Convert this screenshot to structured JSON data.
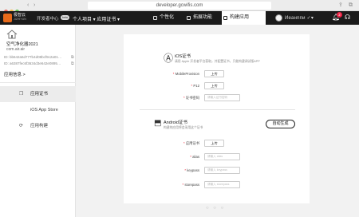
{
  "browser": {
    "url": "developer.gcwifis.com"
  },
  "header": {
    "brand_line1": "极智云",
    "brand_line2": "JIZHIYUN",
    "dev_center": "开发者中心",
    "badge": "beta",
    "breadcrumb": "个人项目 ▾ 应用证书 ▾",
    "tabs": [
      {
        "label": "个性化",
        "icon": "palette-icon"
      },
      {
        "label": "拓展功能",
        "icon": "puzzle-icon"
      },
      {
        "label": "构建应用",
        "icon": "build-icon",
        "active": true
      }
    ],
    "username": "Иeaнnnи ✓▾",
    "notification_count": "2"
  },
  "sidebar": {
    "app_name": "空气净化器2021",
    "app_package": "com.air.air",
    "ids": [
      {
        "label": "ID:",
        "value": "bb642a6d777b4d08bcf9c2a01…"
      },
      {
        "label": "ID:",
        "value": "a6387fec6f3634d3e642e0895…"
      }
    ],
    "app_info_label": "应用信息 >",
    "items": [
      {
        "label": "应用证书",
        "icon": "certificate-icon",
        "glyph": "❒",
        "active": true
      },
      {
        "label": "iOS App Store",
        "icon": "apple-icon",
        "glyph": "",
        "active": false
      },
      {
        "label": "应用构建",
        "icon": "build-icon",
        "glyph": "⟳",
        "active": false
      }
    ]
  },
  "ios": {
    "title": "iOS证书",
    "desc": "请用 Apple 开发者平台获取，并配置证书，只能构建调试版APP",
    "fields": [
      {
        "label": "MobileProvision",
        "type": "upload",
        "value": "上传"
      },
      {
        "label": "P12",
        "type": "upload",
        "value": "上传"
      },
      {
        "label": "证书密码",
        "type": "input",
        "placeholder": "请输入证书密码"
      }
    ]
  },
  "android": {
    "title": "Android证书",
    "desc": "构建的应用将会采用这个证书",
    "auto_generate": "自动生成",
    "fields": [
      {
        "label": "应用证书",
        "type": "upload",
        "value": "上传"
      },
      {
        "label": "alias",
        "type": "input",
        "placeholder": "请输入 alias"
      },
      {
        "label": "keypass",
        "type": "input",
        "placeholder": "请输入 keypass"
      },
      {
        "label": "storepass",
        "type": "input",
        "placeholder": "请输入 storepass"
      }
    ]
  },
  "pager": "○ ○ ○",
  "colors": {
    "brand": "#e86a1a",
    "header_bg": "#1b1b1b",
    "required": "#e22233",
    "notification": "#ee2244"
  }
}
